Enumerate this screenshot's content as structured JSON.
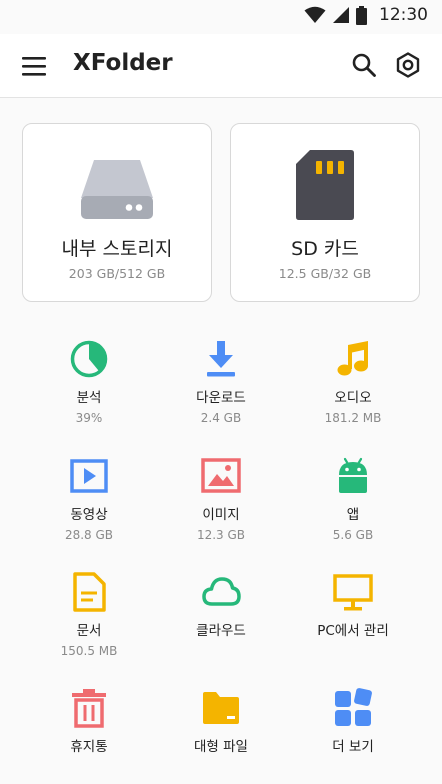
{
  "status_bar": {
    "time": "12:30",
    "icons": [
      "wifi-icon",
      "cell-signal-icon",
      "battery-icon"
    ]
  },
  "app_bar": {
    "title": "XFolder",
    "menu_icon": "menu-icon",
    "search_icon": "search-icon",
    "settings_icon": "settings-icon"
  },
  "storage": [
    {
      "name": "내부 스토리지",
      "size": "203 GB/512 GB",
      "icon": "hard-drive-icon"
    },
    {
      "name": "SD 카드",
      "size": "12.5 GB/32 GB",
      "icon": "sd-card-icon"
    }
  ],
  "categories": [
    {
      "label": "분석",
      "sub": "39%",
      "icon": "pie-chart-icon",
      "value_percent": 39
    },
    {
      "label": "다운로드",
      "sub": "2.4 GB",
      "icon": "download-icon"
    },
    {
      "label": "오디오",
      "sub": "181.2 MB",
      "icon": "music-note-icon"
    },
    {
      "label": "동영상",
      "sub": "28.8 GB",
      "icon": "video-icon"
    },
    {
      "label": "이미지",
      "sub": "12.3 GB",
      "icon": "image-icon"
    },
    {
      "label": "앱",
      "sub": "5.6 GB",
      "icon": "android-icon"
    },
    {
      "label": "문서",
      "sub": "150.5 MB",
      "icon": "document-icon"
    },
    {
      "label": "클라우드",
      "icon": "cloud-icon"
    },
    {
      "label": "PC에서 관리",
      "icon": "monitor-icon"
    },
    {
      "label": "휴지통",
      "icon": "trash-icon"
    },
    {
      "label": "대형 파일",
      "icon": "folder-icon"
    },
    {
      "label": "더 보기",
      "icon": "more-apps-icon"
    }
  ],
  "colors": {
    "green": "#26b87a",
    "blue": "#4e8df5",
    "yellow": "#f4b400",
    "red": "#ef6b6f",
    "drive_gray": "#b6b9c3",
    "card_dark": "#4a4a52"
  }
}
